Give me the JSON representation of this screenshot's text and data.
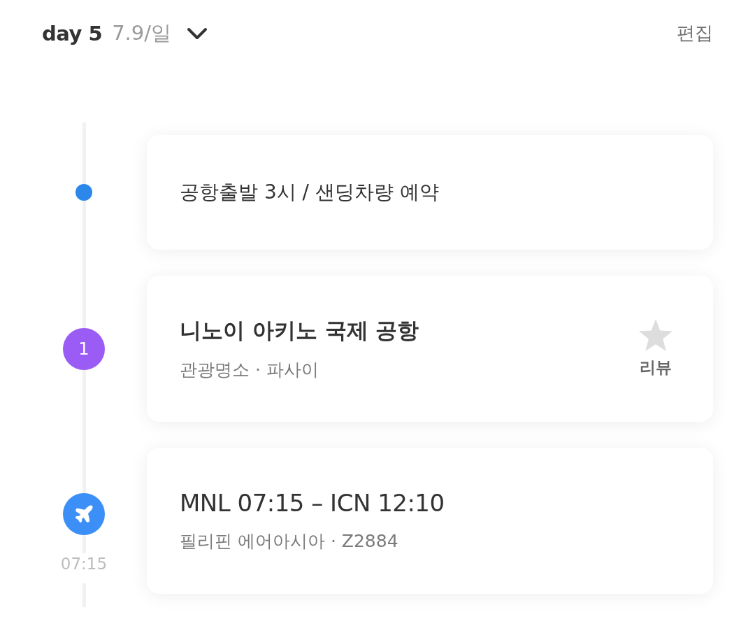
{
  "header": {
    "day": "day 5",
    "date": "7.9/일",
    "edit": "편집"
  },
  "items": [
    {
      "kind": "memo",
      "color": "#2b87e9",
      "text": "공항출발 3시 / 샌딩차량 예약"
    },
    {
      "kind": "place",
      "color": "#9a5cf5",
      "number": "1",
      "title": "니노이 아키노 국제 공항",
      "subtitle": "관광명소 · 파사이",
      "review": "리뷰"
    },
    {
      "kind": "flight",
      "color": "#3b8ff6",
      "time": "07:15",
      "title": "MNL 07:15 – ICN 12:10",
      "subtitle": "필리핀 에어아시아 · Z2884"
    }
  ]
}
